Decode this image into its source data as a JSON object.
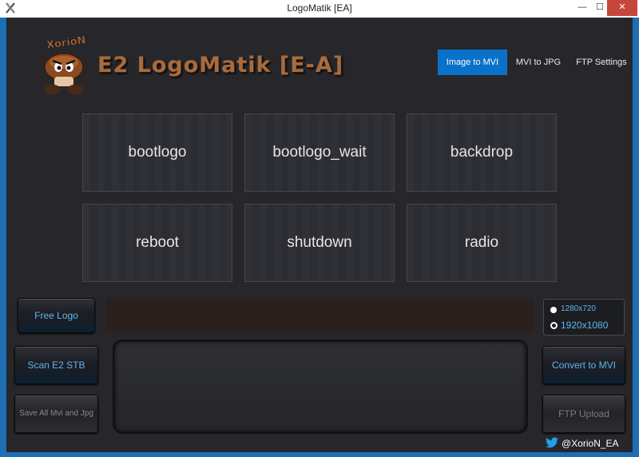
{
  "window": {
    "title": "LogoMatik [EA]",
    "minimize_glyph": "—",
    "maximize_glyph": "☐",
    "close_glyph": "✕"
  },
  "header": {
    "mascot_text": "XorioN",
    "app_title": "E2 LogoMatik [E-A]"
  },
  "nav": {
    "items": [
      {
        "label": "Image to MVI",
        "active": true
      },
      {
        "label": "MVI to JPG",
        "active": false
      },
      {
        "label": "FTP Settings",
        "active": false
      }
    ]
  },
  "tiles": [
    {
      "label": "bootlogo"
    },
    {
      "label": "bootlogo_wait"
    },
    {
      "label": "backdrop"
    },
    {
      "label": "reboot"
    },
    {
      "label": "shutdown"
    },
    {
      "label": "radio"
    }
  ],
  "actions": {
    "free_logo": "Free Logo",
    "scan_stb": "Scan E2 STB",
    "save_all": "Save All Mvi and Jpg",
    "convert": "Convert to MVI",
    "ftp_upload": "FTP Upload"
  },
  "resolution": {
    "options": [
      {
        "label": "1280x720",
        "selected": false
      },
      {
        "label": "1920x1080",
        "selected": true
      }
    ]
  },
  "footer": {
    "twitter_handle": "@XorioN_EA"
  },
  "colors": {
    "accent": "#0a71c9",
    "button_text": "#5fb6ef",
    "background": "#27272b",
    "title_brown": "#a86b3e"
  }
}
